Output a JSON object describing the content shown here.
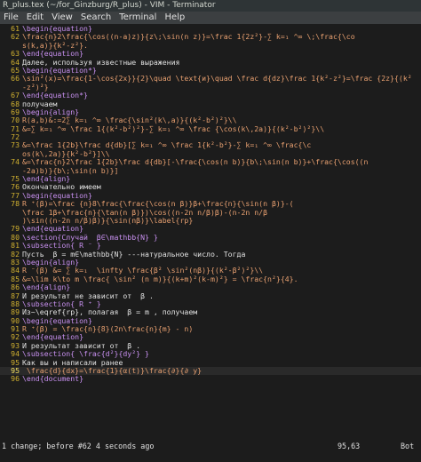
{
  "window": {
    "title": "R_plus.tex (~/for_Ginzburg/R_plus) - VIM - Terminator"
  },
  "menu": [
    "File",
    "Edit",
    "View",
    "Search",
    "Terminal",
    "Help"
  ],
  "lines": [
    {
      "n": "61",
      "t": "\\begin{equation}",
      "c": "kw"
    },
    {
      "n": "62",
      "t": "\\frac{n}2\\frac{\\cos((n-a)z)}{z\\;\\sin(n z)}=\\frac 1{2z²}-∑ k=₁ ^∞ \\;\\frac{\\co",
      "c": "ph"
    },
    {
      "n": "",
      "t": "s(k,a)}{k²-z²}.",
      "c": "ph"
    },
    {
      "n": "63",
      "t": "\\end{equation}",
      "c": "kw"
    },
    {
      "n": "64",
      "t": "Далее, используя известные выражения",
      "c": "txt"
    },
    {
      "n": "65",
      "t": "\\begin{equation*}",
      "c": "kw"
    },
    {
      "n": "66",
      "t": "\\sin²(x)=\\frac{1-\\cos{2x}}{2}\\quad \\text{и}\\quad \\frac d{dz}\\frac 1{k²-z²}=\\frac {2z}{(k²",
      "c": "ph"
    },
    {
      "n": "",
      "t": "-z²)²}",
      "c": "ph"
    },
    {
      "n": "67",
      "t": "\\end{equation*}",
      "c": "kw"
    },
    {
      "n": "68",
      "t": "получаем",
      "c": "txt"
    },
    {
      "n": "69",
      "t": "\\begin{align}",
      "c": "kw"
    },
    {
      "n": "70",
      "t": "R(a,b)&:=2∑ k=₁ ^∞ \\frac{\\sin²(k\\,a)}{(k²-b²)²}\\\\",
      "c": "ph"
    },
    {
      "n": "71",
      "t": "&=∑ k=₁ ^∞ \\frac 1{(k²-b²)²}-∑ k=₁ ^∞ \\frac {\\cos(k\\,2a)}{(k²-b²)²}\\\\",
      "c": "ph"
    },
    {
      "n": "72",
      "t": "",
      "c": "ph"
    },
    {
      "n": "73",
      "t": "&=\\frac 1{2b}\\frac d{db}[∑ k=₁ ^∞ \\frac 1{k²-b²}-∑ k=₁ ^∞ \\frac{\\c",
      "c": "ph"
    },
    {
      "n": "",
      "t": "os(k\\,2a)}{k²-b²}]\\\\",
      "c": "ph"
    },
    {
      "n": "74",
      "t": "&=\\frac{n}2\\frac 1{2b}\\frac d{db}[-\\frac{\\cos(n b)}{b\\;\\sin(n b)}+\\frac{\\cos((n",
      "c": "ph"
    },
    {
      "n": "",
      "t": "-2a)b)}{b\\;\\sin(n b)}]",
      "c": "ph"
    },
    {
      "n": "75",
      "t": "\\end{align}",
      "c": "kw"
    },
    {
      "n": "76",
      "t": "Окончательно имеем",
      "c": "txt"
    },
    {
      "n": "77",
      "t": "\\begin{equation}",
      "c": "kw"
    },
    {
      "n": "78",
      "t": "R ⁺(β)=\\frac {n}8\\frac{\\frac{\\cos(n β)}β+\\frac{n}{\\sin(n β)}-(",
      "c": "ph"
    },
    {
      "n": "",
      "t": "\\frac 1β+\\frac{n}{\\tan(n β)})\\cos((n-2n n/β)β)-(n-2n n/β",
      "c": "ph"
    },
    {
      "n": "",
      "t": ")\\sin((n-2n n/β)β)}{\\sin(nβ)}\\label{rp}",
      "c": "ph"
    },
    {
      "n": "79",
      "t": "\\end{equation}",
      "c": "kw"
    },
    {
      "n": "80",
      "t": "\\section{Случай  β∈\\mathbb{N} }",
      "c": "kw"
    },
    {
      "n": "81",
      "t": "\\subsection{ R ⁻ }",
      "c": "kw"
    },
    {
      "n": "82",
      "t": "Пусть  β = m∈\\mathbb{N} ---натуральное число. Тогда",
      "c": "txt"
    },
    {
      "n": "83",
      "t": "\\begin{align}",
      "c": "kw"
    },
    {
      "n": "84",
      "t": "R ⁻(β) &= ∑ k=₁  \\infty \\frac{β² \\sin²(nβ)}{(k²-β²)²}\\\\",
      "c": "ph"
    },
    {
      "n": "85",
      "t": "&=\\lim k\\to m \\frac{ \\sin² (n m)}{(k+m)²(k-m)²} = \\frac{n²}{4}.",
      "c": "ph"
    },
    {
      "n": "86",
      "t": "\\end{align}",
      "c": "kw"
    },
    {
      "n": "87",
      "t": "И результат не зависит от  β .",
      "c": "txt"
    },
    {
      "n": "88",
      "t": "\\subsection{ R ⁺ }",
      "c": "kw"
    },
    {
      "n": "89",
      "t": "Из~\\eqref{rp}, полагая  β = m , получаем",
      "c": "txt"
    },
    {
      "n": "90",
      "t": "\\begin{equation}",
      "c": "kw"
    },
    {
      "n": "91",
      "t": "R ⁺(β) = \\frac{n}{8}(2n\\frac{n}{m} - n)",
      "c": "ph"
    },
    {
      "n": "92",
      "t": "\\end{equation}",
      "c": "kw"
    },
    {
      "n": "93",
      "t": "И результат зависит от  β .",
      "c": "txt"
    },
    {
      "n": "94",
      "t": "\\subsection{ \\frac{d²}{dy²} }",
      "c": "kw"
    },
    {
      "n": "95",
      "t": "Как вы и написали ранее",
      "c": "txt"
    },
    {
      "n": "95",
      "t": " \\frac{d}{dx}=\\frac{1}{α(t)}\\frac{∂}{∂ y}",
      "c": "ph",
      "current": true
    },
    {
      "n": "96",
      "t": "\\end{document}",
      "c": "kw"
    }
  ],
  "status": {
    "message": "1 change; before #62  4 seconds ago",
    "position": "95,63",
    "scroll": "Bot"
  }
}
